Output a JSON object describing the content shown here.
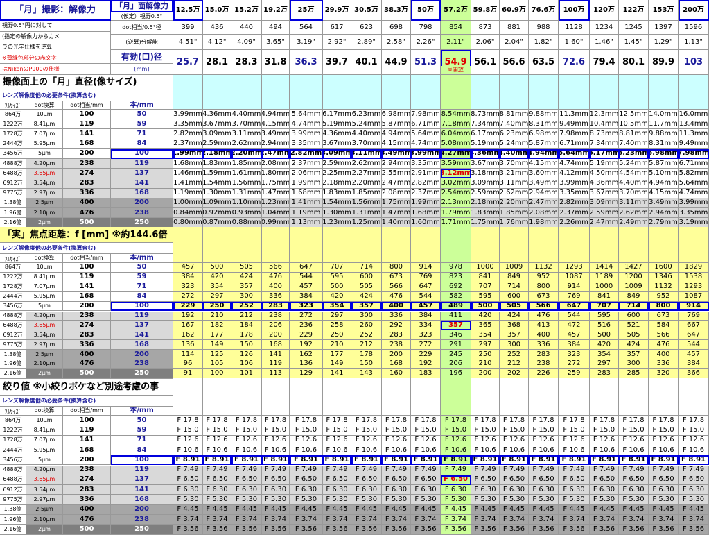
{
  "top": {
    "title_moon": "「月」撮影：解像力",
    "title_res": "「月」面解像力",
    "title_res_sub": "(仮定）視野0.5°",
    "label_dot": "dot相当/0.5°径",
    "label_inv": "(逆算)分解能",
    "label_eff": "有効(口)径",
    "label_mm": "[mm]",
    "note1": "視野0.5°円に対して",
    "note2": "(指定の解像力からカメ",
    "note3": "ラの光学仕様を逆算",
    "note4": "※薄緑色部分の赤文字",
    "note5": "はNikonのP900の仕様",
    "kaiho": "※開放"
  },
  "cols": [
    {
      "res": "12.5万",
      "dot": "399",
      "inv": "4.51\"",
      "eff": "25.7"
    },
    {
      "res": "15.0万",
      "dot": "436",
      "inv": "4.12\"",
      "eff": "28.1"
    },
    {
      "res": "15.2万",
      "dot": "440",
      "inv": "4.09\"",
      "eff": "28.3"
    },
    {
      "res": "19.2万",
      "dot": "494",
      "inv": "3.65\"",
      "eff": "31.8"
    },
    {
      "res": "25万",
      "dot": "564",
      "inv": "3.19\"",
      "eff": "36.3"
    },
    {
      "res": "29.9万",
      "dot": "617",
      "inv": "2.92\"",
      "eff": "39.7"
    },
    {
      "res": "30.5万",
      "dot": "623",
      "inv": "2.89\"",
      "eff": "40.1"
    },
    {
      "res": "38.3万",
      "dot": "698",
      "inv": "2.58\"",
      "eff": "44.9"
    },
    {
      "res": "50万",
      "dot": "798",
      "inv": "2.26\"",
      "eff": "51.3"
    },
    {
      "res": "57.2万",
      "dot": "854",
      "inv": "2.11\"",
      "eff": "54.9"
    },
    {
      "res": "59.8万",
      "dot": "873",
      "inv": "2.06\"",
      "eff": "56.1"
    },
    {
      "res": "60.9万",
      "dot": "881",
      "inv": "2.04\"",
      "eff": "56.6"
    },
    {
      "res": "76.6万",
      "dot": "988",
      "inv": "1.82\"",
      "eff": "63.5"
    },
    {
      "res": "100万",
      "dot": "1128",
      "inv": "1.60\"",
      "eff": "72.6"
    },
    {
      "res": "120万",
      "dot": "1234",
      "inv": "1.46\"",
      "eff": "79.4"
    },
    {
      "res": "122万",
      "dot": "1245",
      "inv": "1.45\"",
      "eff": "80.1"
    },
    {
      "res": "153万",
      "dot": "1397",
      "inv": "1.29\"",
      "eff": "89.9"
    },
    {
      "res": "200万",
      "dot": "1596",
      "inv": "1.13\"",
      "eff": "103"
    }
  ],
  "sections": [
    {
      "title": "撮像面上の「月」直径(像サイズ)",
      "sub": "レンズ解像度他の必要条件(換算含む)"
    },
    {
      "title": "「実」焦点距離：f [mm] ※約144.6倍",
      "sub": "レンズ解像度他の必要条件(換算含む)"
    },
    {
      "title": "絞り値 ※小絞りボケなど別途考慮の事",
      "sub": "レンズ解像度他の必要条件(換算含む)"
    }
  ],
  "head_labels": {
    "fullsize": "ﾌﾙｻｲｽﾞ",
    "dot": "dot換算",
    "dotmm": "dot相当/mm",
    "hon": "本/mm"
  },
  "left_rows": [
    {
      "fs": "864万",
      "um": "10μm",
      "dot": "100",
      "hon": "50"
    },
    {
      "fs": "1222万",
      "um": "8.41μm",
      "dot": "119",
      "hon": "59"
    },
    {
      "fs": "1728万",
      "um": "7.07μm",
      "dot": "141",
      "hon": "71"
    },
    {
      "fs": "2444万",
      "um": "5.95μm",
      "dot": "168",
      "hon": "84"
    },
    {
      "fs": "3456万",
      "um": "5μm",
      "dot": "200",
      "hon": "100"
    },
    {
      "fs": "4888万",
      "um": "4.20μm",
      "dot": "238",
      "hon": "119"
    },
    {
      "fs": "6488万",
      "um": "3.65μm",
      "dot": "274",
      "hon": "137"
    },
    {
      "fs": "6912万",
      "um": "3.54μm",
      "dot": "283",
      "hon": "141"
    },
    {
      "fs": "9775万",
      "um": "2.97μm",
      "dot": "336",
      "hon": "168"
    },
    {
      "fs": "1.38億",
      "um": "2.5μm",
      "dot": "400",
      "hon": "200"
    },
    {
      "fs": "1.96億",
      "um": "2.10μm",
      "dot": "476",
      "hon": "238"
    },
    {
      "fs": "2.16億",
      "um": "2μm",
      "dot": "500",
      "hon": "250"
    }
  ],
  "grid1": [
    [
      "3.99mm",
      "4.36mm",
      "4.40mm",
      "4.94mm",
      "5.64mm",
      "6.17mm",
      "6.23mm",
      "6.98mm",
      "7.98mm",
      "8.54mm",
      "8.73mm",
      "8.81mm",
      "9.88mm",
      "11.3mm",
      "12.3mm",
      "12.5mm",
      "14.0mm",
      "16.0mm"
    ],
    [
      "3.35mm",
      "3.67mm",
      "3.70mm",
      "4.15mm",
      "4.74mm",
      "5.19mm",
      "5.24mm",
      "5.87mm",
      "6.71mm",
      "7.18mm",
      "7.34mm",
      "7.40mm",
      "8.31mm",
      "9.49mm",
      "10.4mm",
      "10.5mm",
      "11.7mm",
      "13.4mm"
    ],
    [
      "2.82mm",
      "3.09mm",
      "3.11mm",
      "3.49mm",
      "3.99mm",
      "4.36mm",
      "4.40mm",
      "4.94mm",
      "5.64mm",
      "6.04mm",
      "6.17mm",
      "6.23mm",
      "6.98mm",
      "7.98mm",
      "8.73mm",
      "8.81mm",
      "9.88mm",
      "11.3mm"
    ],
    [
      "2.37mm",
      "2.59mm",
      "2.62mm",
      "2.94mm",
      "3.35mm",
      "3.67mm",
      "3.70mm",
      "4.15mm",
      "4.74mm",
      "5.08mm",
      "5.19mm",
      "5.24mm",
      "5.87mm",
      "6.71mm",
      "7.34mm",
      "7.40mm",
      "8.31mm",
      "9.49mm"
    ],
    [
      "1.99mm",
      "2.18mm",
      "2.20mm",
      "2.47mm",
      "2.82mm",
      "3.09mm",
      "3.11mm",
      "3.49mm",
      "3.99mm",
      "4.27mm",
      "4.36mm",
      "4.40mm",
      "4.94mm",
      "5.64mm",
      "6.17mm",
      "6.23mm",
      "6.98mm",
      "7.98mm"
    ],
    [
      "1.68mm",
      "1.83mm",
      "1.85mm",
      "2.08mm",
      "2.37mm",
      "2.59mm",
      "2.62mm",
      "2.94mm",
      "3.35mm",
      "3.59mm",
      "3.67mm",
      "3.70mm",
      "4.15mm",
      "4.74mm",
      "5.19mm",
      "5.24mm",
      "5.87mm",
      "6.71mm"
    ],
    [
      "1.46mm",
      "1.59mm",
      "1.61mm",
      "1.80mm",
      "2.06mm",
      "2.25mm",
      "2.27mm",
      "2.55mm",
      "2.91mm",
      "3.12mm",
      "3.18mm",
      "3.21mm",
      "3.60mm",
      "4.12mm",
      "4.50mm",
      "4.54mm",
      "5.10mm",
      "5.82mm"
    ],
    [
      "1.41mm",
      "1.54mm",
      "1.56mm",
      "1.75mm",
      "1.99mm",
      "2.18mm",
      "2.20mm",
      "2.47mm",
      "2.82mm",
      "3.02mm",
      "3.09mm",
      "3.11mm",
      "3.49mm",
      "3.99mm",
      "4.36mm",
      "4.40mm",
      "4.94mm",
      "5.64mm"
    ],
    [
      "1.19mm",
      "1.30mm",
      "1.31mm",
      "1.47mm",
      "1.68mm",
      "1.83mm",
      "1.85mm",
      "2.08mm",
      "2.37mm",
      "2.54mm",
      "2.59mm",
      "2.62mm",
      "2.94mm",
      "3.35mm",
      "3.67mm",
      "3.70mm",
      "4.15mm",
      "4.74mm"
    ],
    [
      "1.00mm",
      "1.09mm",
      "1.10mm",
      "1.23mm",
      "1.41mm",
      "1.54mm",
      "1.56mm",
      "1.75mm",
      "1.99mm",
      "2.13mm",
      "2.18mm",
      "2.20mm",
      "2.47mm",
      "2.82mm",
      "3.09mm",
      "3.11mm",
      "3.49mm",
      "3.99mm"
    ],
    [
      "0.84mm",
      "0.92mm",
      "0.93mm",
      "1.04mm",
      "1.19mm",
      "1.30mm",
      "1.31mm",
      "1.47mm",
      "1.68mm",
      "1.79mm",
      "1.83mm",
      "1.85mm",
      "2.08mm",
      "2.37mm",
      "2.59mm",
      "2.62mm",
      "2.94mm",
      "3.35mm"
    ],
    [
      "0.80mm",
      "0.87mm",
      "0.88mm",
      "0.99mm",
      "1.13mm",
      "1.23mm",
      "1.25mm",
      "1.40mm",
      "1.60mm",
      "1.71mm",
      "1.75mm",
      "1.76mm",
      "1.98mm",
      "2.26mm",
      "2.47mm",
      "2.49mm",
      "2.79mm",
      "3.19mm"
    ]
  ],
  "grid2": [
    [
      "457",
      "500",
      "505",
      "566",
      "647",
      "707",
      "714",
      "800",
      "914",
      "978",
      "1000",
      "1009",
      "1132",
      "1293",
      "1414",
      "1427",
      "1600",
      "1829"
    ],
    [
      "384",
      "420",
      "424",
      "476",
      "544",
      "595",
      "600",
      "673",
      "769",
      "823",
      "841",
      "849",
      "952",
      "1087",
      "1189",
      "1200",
      "1346",
      "1538"
    ],
    [
      "323",
      "354",
      "357",
      "400",
      "457",
      "500",
      "505",
      "566",
      "647",
      "692",
      "707",
      "714",
      "800",
      "914",
      "1000",
      "1009",
      "1132",
      "1293"
    ],
    [
      "272",
      "297",
      "300",
      "336",
      "384",
      "420",
      "424",
      "476",
      "544",
      "582",
      "595",
      "600",
      "673",
      "769",
      "841",
      "849",
      "952",
      "1087"
    ],
    [
      "229",
      "250",
      "252",
      "283",
      "323",
      "354",
      "357",
      "400",
      "457",
      "489",
      "500",
      "505",
      "566",
      "647",
      "707",
      "714",
      "800",
      "914"
    ],
    [
      "192",
      "210",
      "212",
      "238",
      "272",
      "297",
      "300",
      "336",
      "384",
      "411",
      "420",
      "424",
      "476",
      "544",
      "595",
      "600",
      "673",
      "769"
    ],
    [
      "167",
      "182",
      "184",
      "206",
      "236",
      "258",
      "260",
      "292",
      "334",
      "357",
      "365",
      "368",
      "413",
      "472",
      "516",
      "521",
      "584",
      "667"
    ],
    [
      "162",
      "177",
      "178",
      "200",
      "229",
      "250",
      "252",
      "283",
      "323",
      "346",
      "354",
      "357",
      "400",
      "457",
      "500",
      "505",
      "566",
      "647"
    ],
    [
      "136",
      "149",
      "150",
      "168",
      "192",
      "210",
      "212",
      "238",
      "272",
      "291",
      "297",
      "300",
      "336",
      "384",
      "420",
      "424",
      "476",
      "544"
    ],
    [
      "114",
      "125",
      "126",
      "141",
      "162",
      "177",
      "178",
      "200",
      "229",
      "245",
      "250",
      "252",
      "283",
      "323",
      "354",
      "357",
      "400",
      "457"
    ],
    [
      "96",
      "105",
      "106",
      "119",
      "136",
      "149",
      "150",
      "168",
      "192",
      "206",
      "210",
      "212",
      "238",
      "272",
      "297",
      "300",
      "336",
      "384"
    ],
    [
      "91",
      "100",
      "101",
      "113",
      "129",
      "141",
      "143",
      "160",
      "183",
      "196",
      "200",
      "202",
      "226",
      "259",
      "283",
      "285",
      "320",
      "366"
    ]
  ],
  "grid3": [
    [
      "F 17.8",
      "F 17.8",
      "F 17.8",
      "F 17.8",
      "F 17.8",
      "F 17.8",
      "F 17.8",
      "F 17.8",
      "F 17.8",
      "F 17.8",
      "F 17.8",
      "F 17.8",
      "F 17.8",
      "F 17.8",
      "F 17.8",
      "F 17.8",
      "F 17.8",
      "F 17.8"
    ],
    [
      "F 15.0",
      "F 15.0",
      "F 15.0",
      "F 15.0",
      "F 15.0",
      "F 15.0",
      "F 15.0",
      "F 15.0",
      "F 15.0",
      "F 15.0",
      "F 15.0",
      "F 15.0",
      "F 15.0",
      "F 15.0",
      "F 15.0",
      "F 15.0",
      "F 15.0",
      "F 15.0"
    ],
    [
      "F 12.6",
      "F 12.6",
      "F 12.6",
      "F 12.6",
      "F 12.6",
      "F 12.6",
      "F 12.6",
      "F 12.6",
      "F 12.6",
      "F 12.6",
      "F 12.6",
      "F 12.6",
      "F 12.6",
      "F 12.6",
      "F 12.6",
      "F 12.6",
      "F 12.6",
      "F 12.6"
    ],
    [
      "F 10.6",
      "F 10.6",
      "F 10.6",
      "F 10.6",
      "F 10.6",
      "F 10.6",
      "F 10.6",
      "F 10.6",
      "F 10.6",
      "F 10.6",
      "F 10.6",
      "F 10.6",
      "F 10.6",
      "F 10.6",
      "F 10.6",
      "F 10.6",
      "F 10.6",
      "F 10.6"
    ],
    [
      "F 8.91",
      "F 8.91",
      "F 8.91",
      "F 8.91",
      "F 8.91",
      "F 8.91",
      "F 8.91",
      "F 8.91",
      "F 8.91",
      "F 8.91",
      "F 8.91",
      "F 8.91",
      "F 8.91",
      "F 8.91",
      "F 8.91",
      "F 8.91",
      "F 8.91",
      "F 8.91"
    ],
    [
      "F 7.49",
      "F 7.49",
      "F 7.49",
      "F 7.49",
      "F 7.49",
      "F 7.49",
      "F 7.49",
      "F 7.49",
      "F 7.49",
      "F 7.49",
      "F 7.49",
      "F 7.49",
      "F 7.49",
      "F 7.49",
      "F 7.49",
      "F 7.49",
      "F 7.49",
      "F 7.49"
    ],
    [
      "F 6.50",
      "F 6.50",
      "F 6.50",
      "F 6.50",
      "F 6.50",
      "F 6.50",
      "F 6.50",
      "F 6.50",
      "F 6.50",
      "F 6.50",
      "F 6.50",
      "F 6.50",
      "F 6.50",
      "F 6.50",
      "F 6.50",
      "F 6.50",
      "F 6.50",
      "F 6.50"
    ],
    [
      "F 6.30",
      "F 6.30",
      "F 6.30",
      "F 6.30",
      "F 6.30",
      "F 6.30",
      "F 6.30",
      "F 6.30",
      "F 6.30",
      "F 6.30",
      "F 6.30",
      "F 6.30",
      "F 6.30",
      "F 6.30",
      "F 6.30",
      "F 6.30",
      "F 6.30",
      "F 6.30"
    ],
    [
      "F 5.30",
      "F 5.30",
      "F 5.30",
      "F 5.30",
      "F 5.30",
      "F 5.30",
      "F 5.30",
      "F 5.30",
      "F 5.30",
      "F 5.30",
      "F 5.30",
      "F 5.30",
      "F 5.30",
      "F 5.30",
      "F 5.30",
      "F 5.30",
      "F 5.30",
      "F 5.30"
    ],
    [
      "F 4.45",
      "F 4.45",
      "F 4.45",
      "F 4.45",
      "F 4.45",
      "F 4.45",
      "F 4.45",
      "F 4.45",
      "F 4.45",
      "F 4.45",
      "F 4.45",
      "F 4.45",
      "F 4.45",
      "F 4.45",
      "F 4.45",
      "F 4.45",
      "F 4.45",
      "F 4.45"
    ],
    [
      "F 3.74",
      "F 3.74",
      "F 3.74",
      "F 3.74",
      "F 3.74",
      "F 3.74",
      "F 3.74",
      "F 3.74",
      "F 3.74",
      "F 3.74",
      "F 3.74",
      "F 3.74",
      "F 3.74",
      "F 3.74",
      "F 3.74",
      "F 3.74",
      "F 3.74",
      "F 3.74"
    ],
    [
      "F 3.56",
      "F 3.56",
      "F 3.56",
      "F 3.56",
      "F 3.56",
      "F 3.56",
      "F 3.56",
      "F 3.56",
      "F 3.56",
      "F 3.56",
      "F 3.56",
      "F 3.56",
      "F 3.56",
      "F 3.56",
      "F 3.56",
      "F 3.56",
      "F 3.56",
      "F 3.56"
    ]
  ],
  "colors": {
    "highlight_green": "#ccff99",
    "yellow": "#ffff99",
    "cyan": "#ccffff",
    "box_blue": "#0000dd",
    "red_text": "#e00000"
  }
}
